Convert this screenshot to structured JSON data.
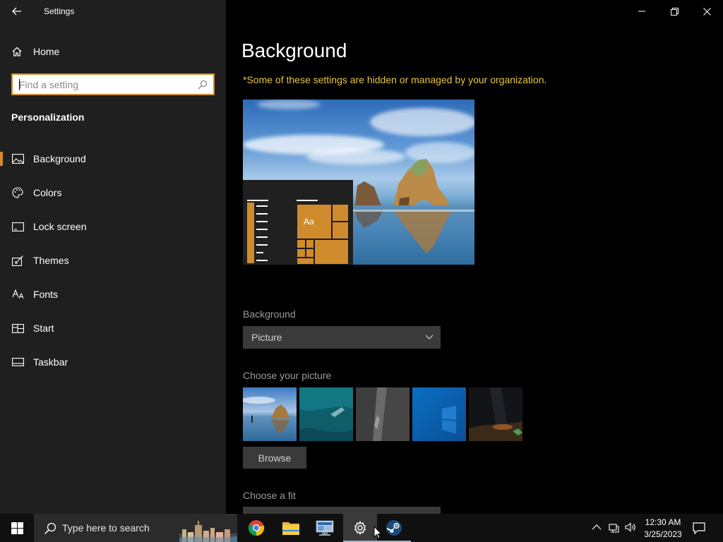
{
  "window": {
    "title": "Settings",
    "controls": [
      "minimize",
      "restore",
      "close"
    ]
  },
  "sidebar": {
    "home_label": "Home",
    "search_placeholder": "Find a setting",
    "section_title": "Personalization",
    "items": [
      {
        "label": "Background",
        "icon": "picture-icon",
        "active": true
      },
      {
        "label": "Colors",
        "icon": "palette-icon",
        "active": false
      },
      {
        "label": "Lock screen",
        "icon": "lock-screen-icon",
        "active": false
      },
      {
        "label": "Themes",
        "icon": "themes-icon",
        "active": false
      },
      {
        "label": "Fonts",
        "icon": "fonts-icon",
        "active": false
      },
      {
        "label": "Start",
        "icon": "start-icon",
        "active": false
      },
      {
        "label": "Taskbar",
        "icon": "taskbar-icon",
        "active": false
      }
    ]
  },
  "main": {
    "title": "Background",
    "org_notice": "*Some of these settings are hidden or managed by your organization.",
    "preview": {
      "tile_text": "Aa"
    },
    "background_label": "Background",
    "background_value": "Picture",
    "choose_picture_label": "Choose your picture",
    "browse_label": "Browse",
    "choose_fit_label": "Choose a fit"
  },
  "taskbar": {
    "search_text": "Type here to search",
    "apps": [
      "chrome-icon",
      "file-explorer-icon",
      "remote-desktop-icon",
      "settings-icon",
      "steam-icon"
    ],
    "time": "12:30 AM",
    "date": "3/25/2023"
  },
  "colors": {
    "accent": "#d08b2d",
    "notice": "#e6c643",
    "sidebar_bg": "#1f1f1f",
    "main_bg": "#000000"
  }
}
